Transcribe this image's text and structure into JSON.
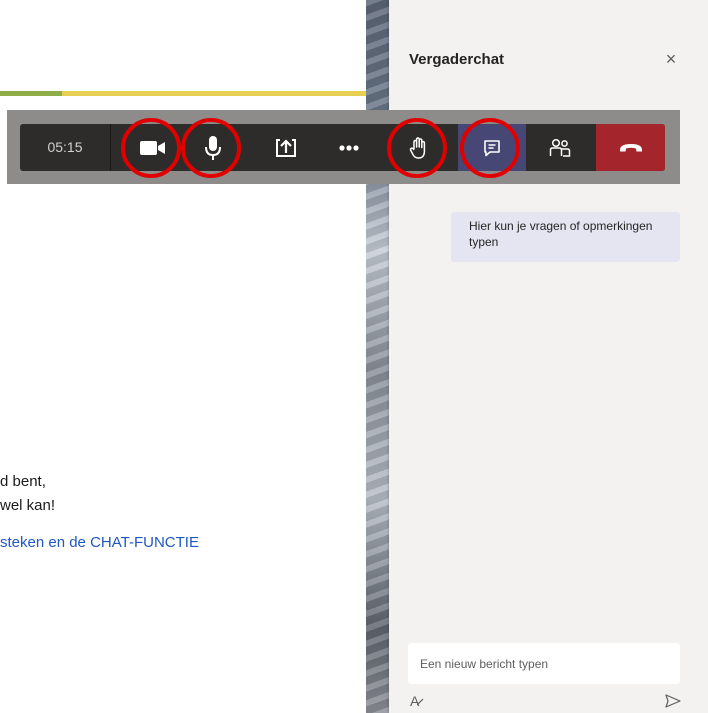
{
  "document": {
    "line1": "d bent,",
    "line2": "wel kan!",
    "line3": "steken en de CHAT-FUNCTIE"
  },
  "chat": {
    "title": "Vergaderchat",
    "close_symbol": "×",
    "message": "Hier kun je vragen of opmerkingen typen",
    "compose_placeholder": "Een nieuw bericht typen",
    "format_symbol": "A"
  },
  "toolbar": {
    "elapsed_time": "05:15",
    "buttons": [
      "camera-icon",
      "microphone-icon",
      "share-screen-icon",
      "more-options-icon",
      "raise-hand-icon",
      "chat-icon",
      "participants-icon",
      "hang-up-icon"
    ],
    "highlighted": [
      "camera-icon",
      "microphone-icon",
      "raise-hand-icon",
      "chat-icon"
    ]
  },
  "colors": {
    "toolbar_bg": "#2d2c2b",
    "chat_active": "#464775",
    "hang_up": "#a4262c",
    "highlight_ring": "#e00000",
    "link_blue": "#1f57c4"
  }
}
